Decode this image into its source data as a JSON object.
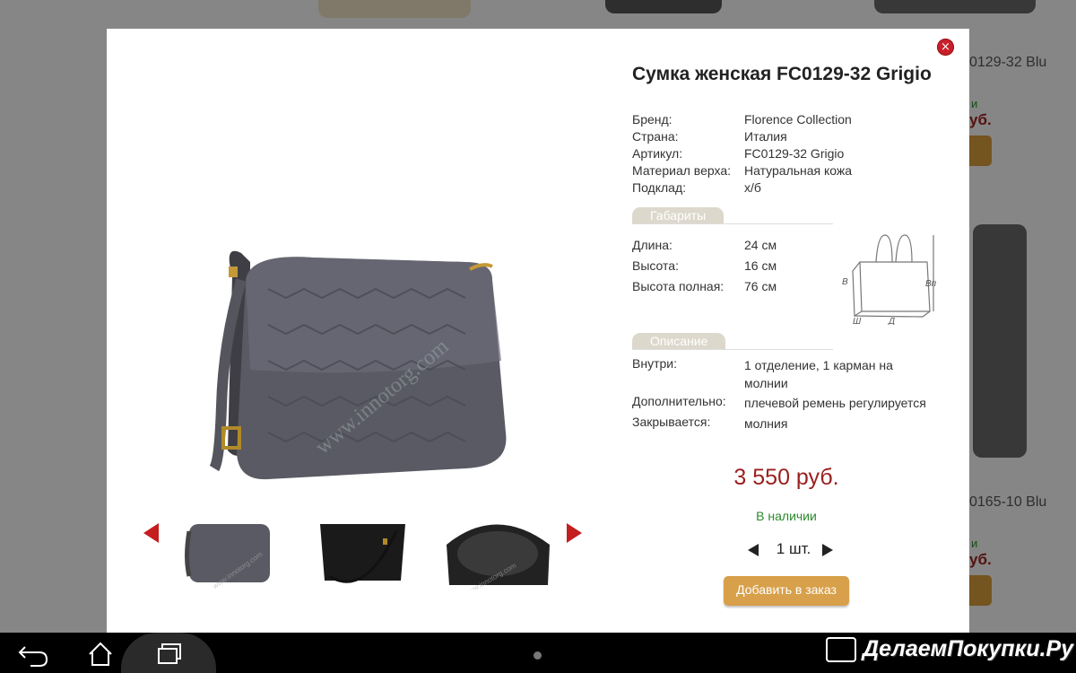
{
  "background": {
    "article_1": "0129-32 Blu",
    "price_1": "уб.",
    "stock_1": "и",
    "article_2": "0165-10 Blu",
    "price_2": "уб.",
    "stock_2": "и"
  },
  "modal": {
    "close_label": "×",
    "title": "Сумка женская FC0129-32 Grigio",
    "specs": [
      {
        "label": "Бренд:",
        "value": "Florence Collection"
      },
      {
        "label": "Страна:",
        "value": "Италия"
      },
      {
        "label": "Артикул:",
        "value": "FC0129-32 Grigio"
      },
      {
        "label": "Материал верха:",
        "value": "Натуральная кожа"
      },
      {
        "label": "Подклад:",
        "value": "х/б"
      }
    ],
    "dimensions_heading": "Габариты",
    "dimensions": [
      {
        "label": "Длина:",
        "value": "24 см"
      },
      {
        "label": "Высота:",
        "value": "16 см"
      },
      {
        "label": "Высота полная:",
        "value": "76 см"
      }
    ],
    "sketch_labels": {
      "h": "В",
      "hp": "Вп",
      "w": "Ш",
      "l": "Д"
    },
    "description_heading": "Описание",
    "description": [
      {
        "label": "Внутри:",
        "value": "1 отделение, 1 карман на молнии"
      },
      {
        "label": "Дополнительно:",
        "value": "плечевой ремень регулируется"
      },
      {
        "label": "Закрывается:",
        "value": "молния"
      }
    ],
    "price": "3 550 руб.",
    "stock": "В наличии",
    "quantity": "1 шт.",
    "add_button": "Добавить в заказ",
    "image_watermark": "www.innotorg.com",
    "thumb_watermark": "www.innotorg.com"
  },
  "system_bar": {
    "watermark": "ДелаемПокупки.Ру"
  },
  "colors": {
    "price": "#9a1f1f",
    "stock": "#2a8a2a",
    "accent_button": "#d8a04a",
    "arrows": "#c41e1e"
  }
}
